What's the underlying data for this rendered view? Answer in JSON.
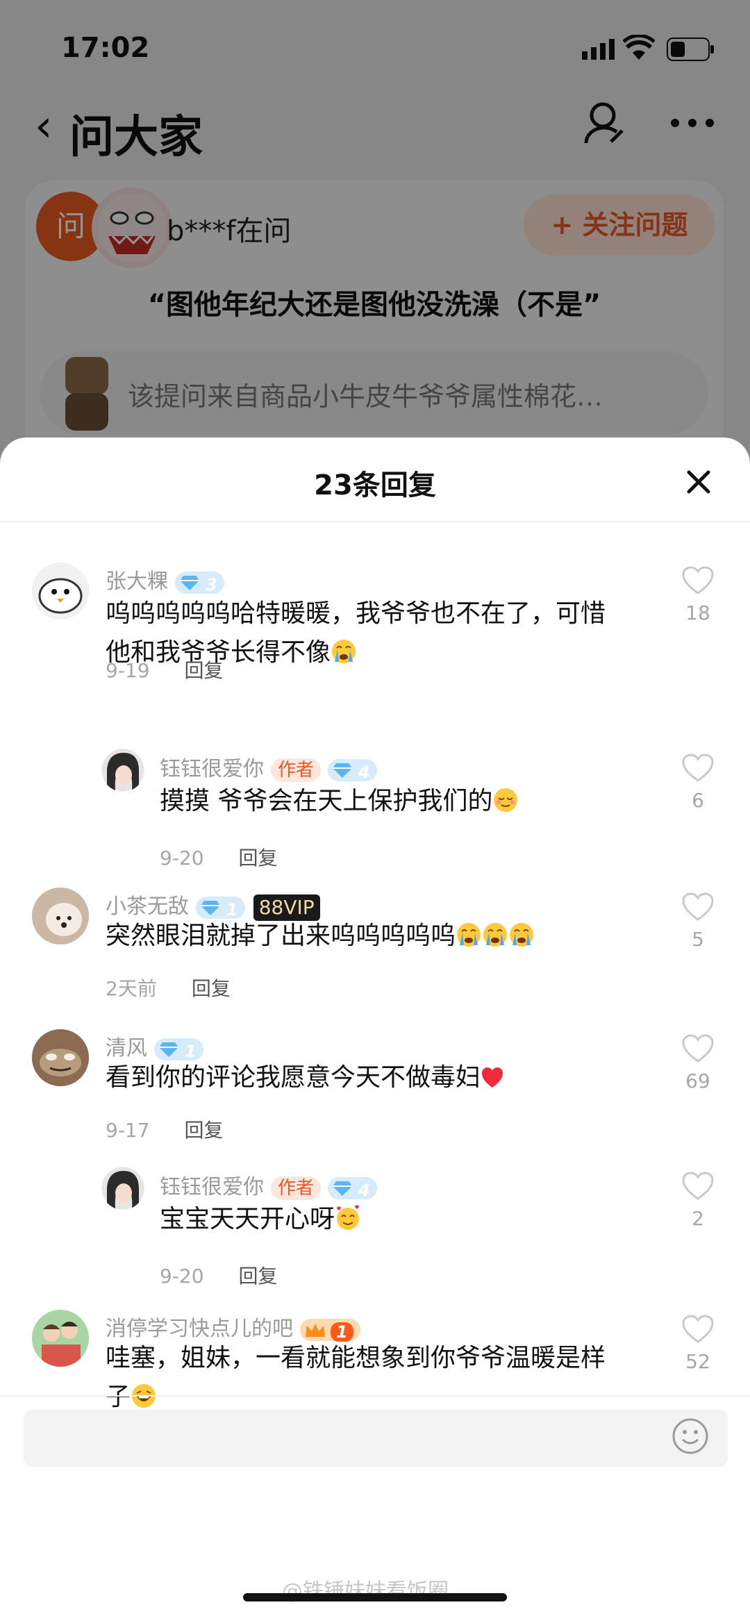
{
  "status_bar": {
    "time": "17:02"
  },
  "nav": {
    "back_glyph": "‹",
    "title": "问大家",
    "icons": [
      "person-edit-icon",
      "more-icon"
    ]
  },
  "question": {
    "badge": "问",
    "asker": "b***f在问",
    "follow_label": "+ 关注问题",
    "title": "“图他年纪大还是图他没洗澡（不是”",
    "source": "该提问来自商品小牛皮牛爷爷属性棉花…"
  },
  "sheet": {
    "title": "23条回复",
    "close_icon": "close-icon"
  },
  "comments": [
    {
      "name": "张大粿",
      "level": "3",
      "text_lines": [
        "呜呜呜呜呜哈特暖暖，我爷爷也不在了，可惜",
        "他和我爷爷长得不像"
      ],
      "date": "9-19",
      "reply": "回复",
      "likes": "18"
    },
    {
      "name": "钰钰很爱你",
      "author_tag": "作者",
      "level": "4",
      "text_lines": [
        "摸摸 爷爷会在天上保护我们的"
      ],
      "date": "9-20",
      "reply": "回复",
      "likes": "6"
    },
    {
      "name": "小茶无敌",
      "level": "1",
      "vip": "88VIP",
      "text_lines": [
        "突然眼泪就掉了出来呜呜呜呜呜"
      ],
      "date": "2天前",
      "reply": "回复",
      "likes": "5"
    },
    {
      "name": "清风",
      "level": "1",
      "text_lines": [
        "看到你的评论我愿意今天不做毒妇"
      ],
      "date": "9-17",
      "reply": "回复",
      "likes": "69"
    },
    {
      "name": "钰钰很爱你",
      "author_tag": "作者",
      "level": "4",
      "text_lines": [
        "宝宝天天开心呀"
      ],
      "date": "9-20",
      "reply": "回复",
      "likes": "2"
    },
    {
      "name": "消停学习快点儿的吧",
      "level": "1",
      "text_lines": [
        "哇塞，姐妹，一看就能想象到你爷爷温暖是样",
        "子"
      ],
      "likes": "52"
    }
  ],
  "watermark": "@铁锤妹妹看饭圈",
  "colors": {
    "accent": "#e8592a",
    "level_blue": "#5bb6f0"
  }
}
